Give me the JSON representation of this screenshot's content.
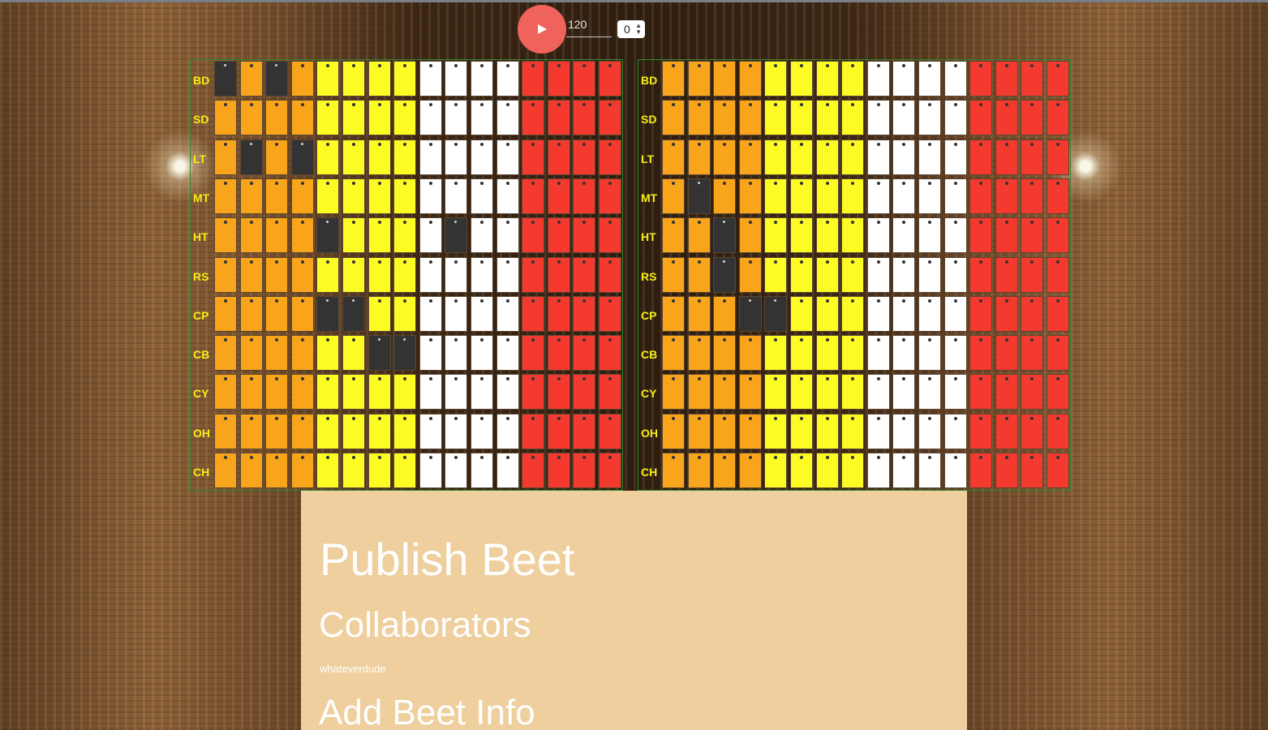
{
  "controls": {
    "play_icon": "play-icon",
    "tempo_value": "120",
    "pattern_number": "0"
  },
  "colors": {
    "orange": "#f8a51c",
    "yellow": "#fdfb24",
    "white": "#ffffff",
    "red": "#f43a2f",
    "active": "#333333",
    "label": "#f5ee18",
    "play_button": "#f0635c",
    "publish_panel": "#eecf9d"
  },
  "sequencer": {
    "rows": [
      "BD",
      "SD",
      "LT",
      "MT",
      "HT",
      "RS",
      "CP",
      "CB",
      "CY",
      "OH",
      "CH"
    ],
    "steps_per_grid": 16,
    "grids": [
      {
        "name": "left",
        "active": {
          "BD": [
            0,
            2
          ],
          "LT": [
            1,
            3
          ],
          "HT": [
            4,
            9
          ],
          "CP": [
            4,
            5
          ],
          "CB": [
            6,
            7
          ]
        }
      },
      {
        "name": "right",
        "active": {
          "MT": [
            1
          ],
          "HT": [
            2
          ],
          "RS": [
            2
          ],
          "CP": [
            3,
            4
          ]
        }
      }
    ]
  },
  "publish": {
    "title": "Publish Beet",
    "collaborators_heading": "Collaborators",
    "collaborators": [
      "whateverdude"
    ],
    "info_heading": "Add Beet Info"
  }
}
